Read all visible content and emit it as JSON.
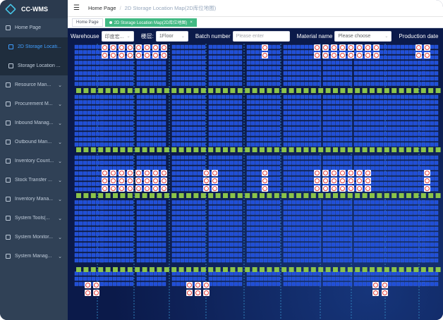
{
  "app": {
    "title": "CC-WMS"
  },
  "sidebar": {
    "items": [
      {
        "label": "Home Page",
        "name": "sidebar-item-home",
        "arrow": false,
        "sub": false,
        "active": false
      },
      {
        "label": "2D Storage Locati...",
        "name": "sidebar-item-2d-storage-location-map",
        "arrow": false,
        "sub": true,
        "active": true
      },
      {
        "label": "Storage Location ...",
        "name": "sidebar-item-storage-location",
        "arrow": false,
        "sub": true,
        "active": false
      },
      {
        "label": "Resource Man...",
        "name": "sidebar-item-resource-management",
        "arrow": true,
        "sub": false,
        "active": false
      },
      {
        "label": "Procurement M...",
        "name": "sidebar-item-procurement-management",
        "arrow": true,
        "sub": false,
        "active": false
      },
      {
        "label": "Inbound Manag...",
        "name": "sidebar-item-inbound-management",
        "arrow": true,
        "sub": false,
        "active": false
      },
      {
        "label": "Outbound Man...",
        "name": "sidebar-item-outbound-management",
        "arrow": true,
        "sub": false,
        "active": false
      },
      {
        "label": "Inventory Count...",
        "name": "sidebar-item-inventory-count",
        "arrow": true,
        "sub": false,
        "active": false
      },
      {
        "label": "Stock Transfer ...",
        "name": "sidebar-item-stock-transfer",
        "arrow": true,
        "sub": false,
        "active": false
      },
      {
        "label": "Inventory Mana...",
        "name": "sidebar-item-inventory-management",
        "arrow": true,
        "sub": false,
        "active": false
      },
      {
        "label": "System Tools(...",
        "name": "sidebar-item-system-tools",
        "arrow": true,
        "sub": false,
        "active": false
      },
      {
        "label": "System Monitor...",
        "name": "sidebar-item-system-monitor",
        "arrow": true,
        "sub": false,
        "active": false
      },
      {
        "label": "System Manag...",
        "name": "sidebar-item-system-management",
        "arrow": true,
        "sub": false,
        "active": false
      }
    ]
  },
  "navbar": {
    "breadcrumb": [
      "Home Page",
      "2D Storage Location Map(2D库位地图)"
    ]
  },
  "tags": [
    {
      "label": "Home Page",
      "active": false
    },
    {
      "label": "2D Storage Location Map(2D库位地图)",
      "active": true
    }
  ],
  "filters": {
    "warehouse_label": "Warehouse",
    "warehouse_value": "印度宏...",
    "floor_label": "楼层:",
    "floor_value": "1Floor",
    "batch_label": "Batch number",
    "batch_placeholder": "Please enter",
    "material_label": "Material name",
    "material_value": "Please choose",
    "production_label": "Production date"
  },
  "colors": {
    "sidebar_bg": "#304156",
    "map_bg": "#0b1a4a",
    "slot_blue": "#1f4ed8",
    "slot_occupied_red": "#e03b3b",
    "aisle_green": "#8bc34a",
    "active_tag": "#42b983"
  },
  "map": {
    "icons": {
      "empty_slot": "grid-slot-icon",
      "occupied_slot": "no-entry-icon",
      "aisle_marker": "green-square-icon"
    }
  }
}
